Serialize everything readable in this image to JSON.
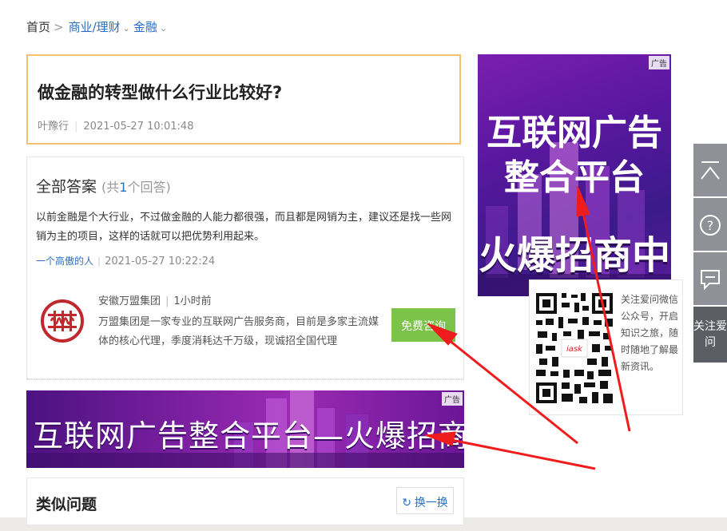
{
  "breadcrumb": {
    "home": "首页",
    "separator": ">",
    "category": "商业/理财",
    "subcategory": "金融"
  },
  "question": {
    "title": "做金融的转型做什么行业比较好?",
    "author": "叶豫行",
    "timestamp": "2021-05-27 10:01:48"
  },
  "answers": {
    "heading": "全部答案",
    "count_prefix": "(共",
    "count": "1",
    "count_suffix": "个回答)",
    "items": [
      {
        "text": "以前金融是个大行业，不过做金融的人能力都很强，而且都是网销为主，建议还是找一些网销为主的项目，这样的话就可以把优势利用起来。",
        "author": "一个高傲的人",
        "timestamp": "2021-05-27 10:22:24"
      }
    ]
  },
  "advertiser": {
    "name": "安徽万盟集团",
    "time": "1小时前",
    "description": "万盟集团是一家专业的互联网广告服务商，目前是多家主流媒体的核心代理，季度消耗达千万级，现诚招全国代理",
    "button_label": "免费咨询",
    "brand_color": "#c0282d"
  },
  "ad_banner": {
    "tag": "广告",
    "text": "互联网广告整合平台—火爆招商中"
  },
  "side_ad": {
    "tag": "广告",
    "line1": "互联网广告",
    "line2": "整合平台",
    "line3": "火爆招商中"
  },
  "wechat": {
    "text": "关注爱问微信公众号，开启知识之旅，随时随地了解最新资讯。",
    "qr_label": "iask"
  },
  "similar": {
    "title": "类似问题",
    "refresh_label": "换一换"
  },
  "float_bar": {
    "follow_label": "关注爱问",
    "items": [
      "back-to-top-icon",
      "help-icon",
      "feedback-icon"
    ]
  },
  "colors": {
    "link": "#2a6fc4",
    "question_border": "#f5c16c",
    "consult_button": "#7cc34a",
    "arrow": "#ee1c1c"
  }
}
